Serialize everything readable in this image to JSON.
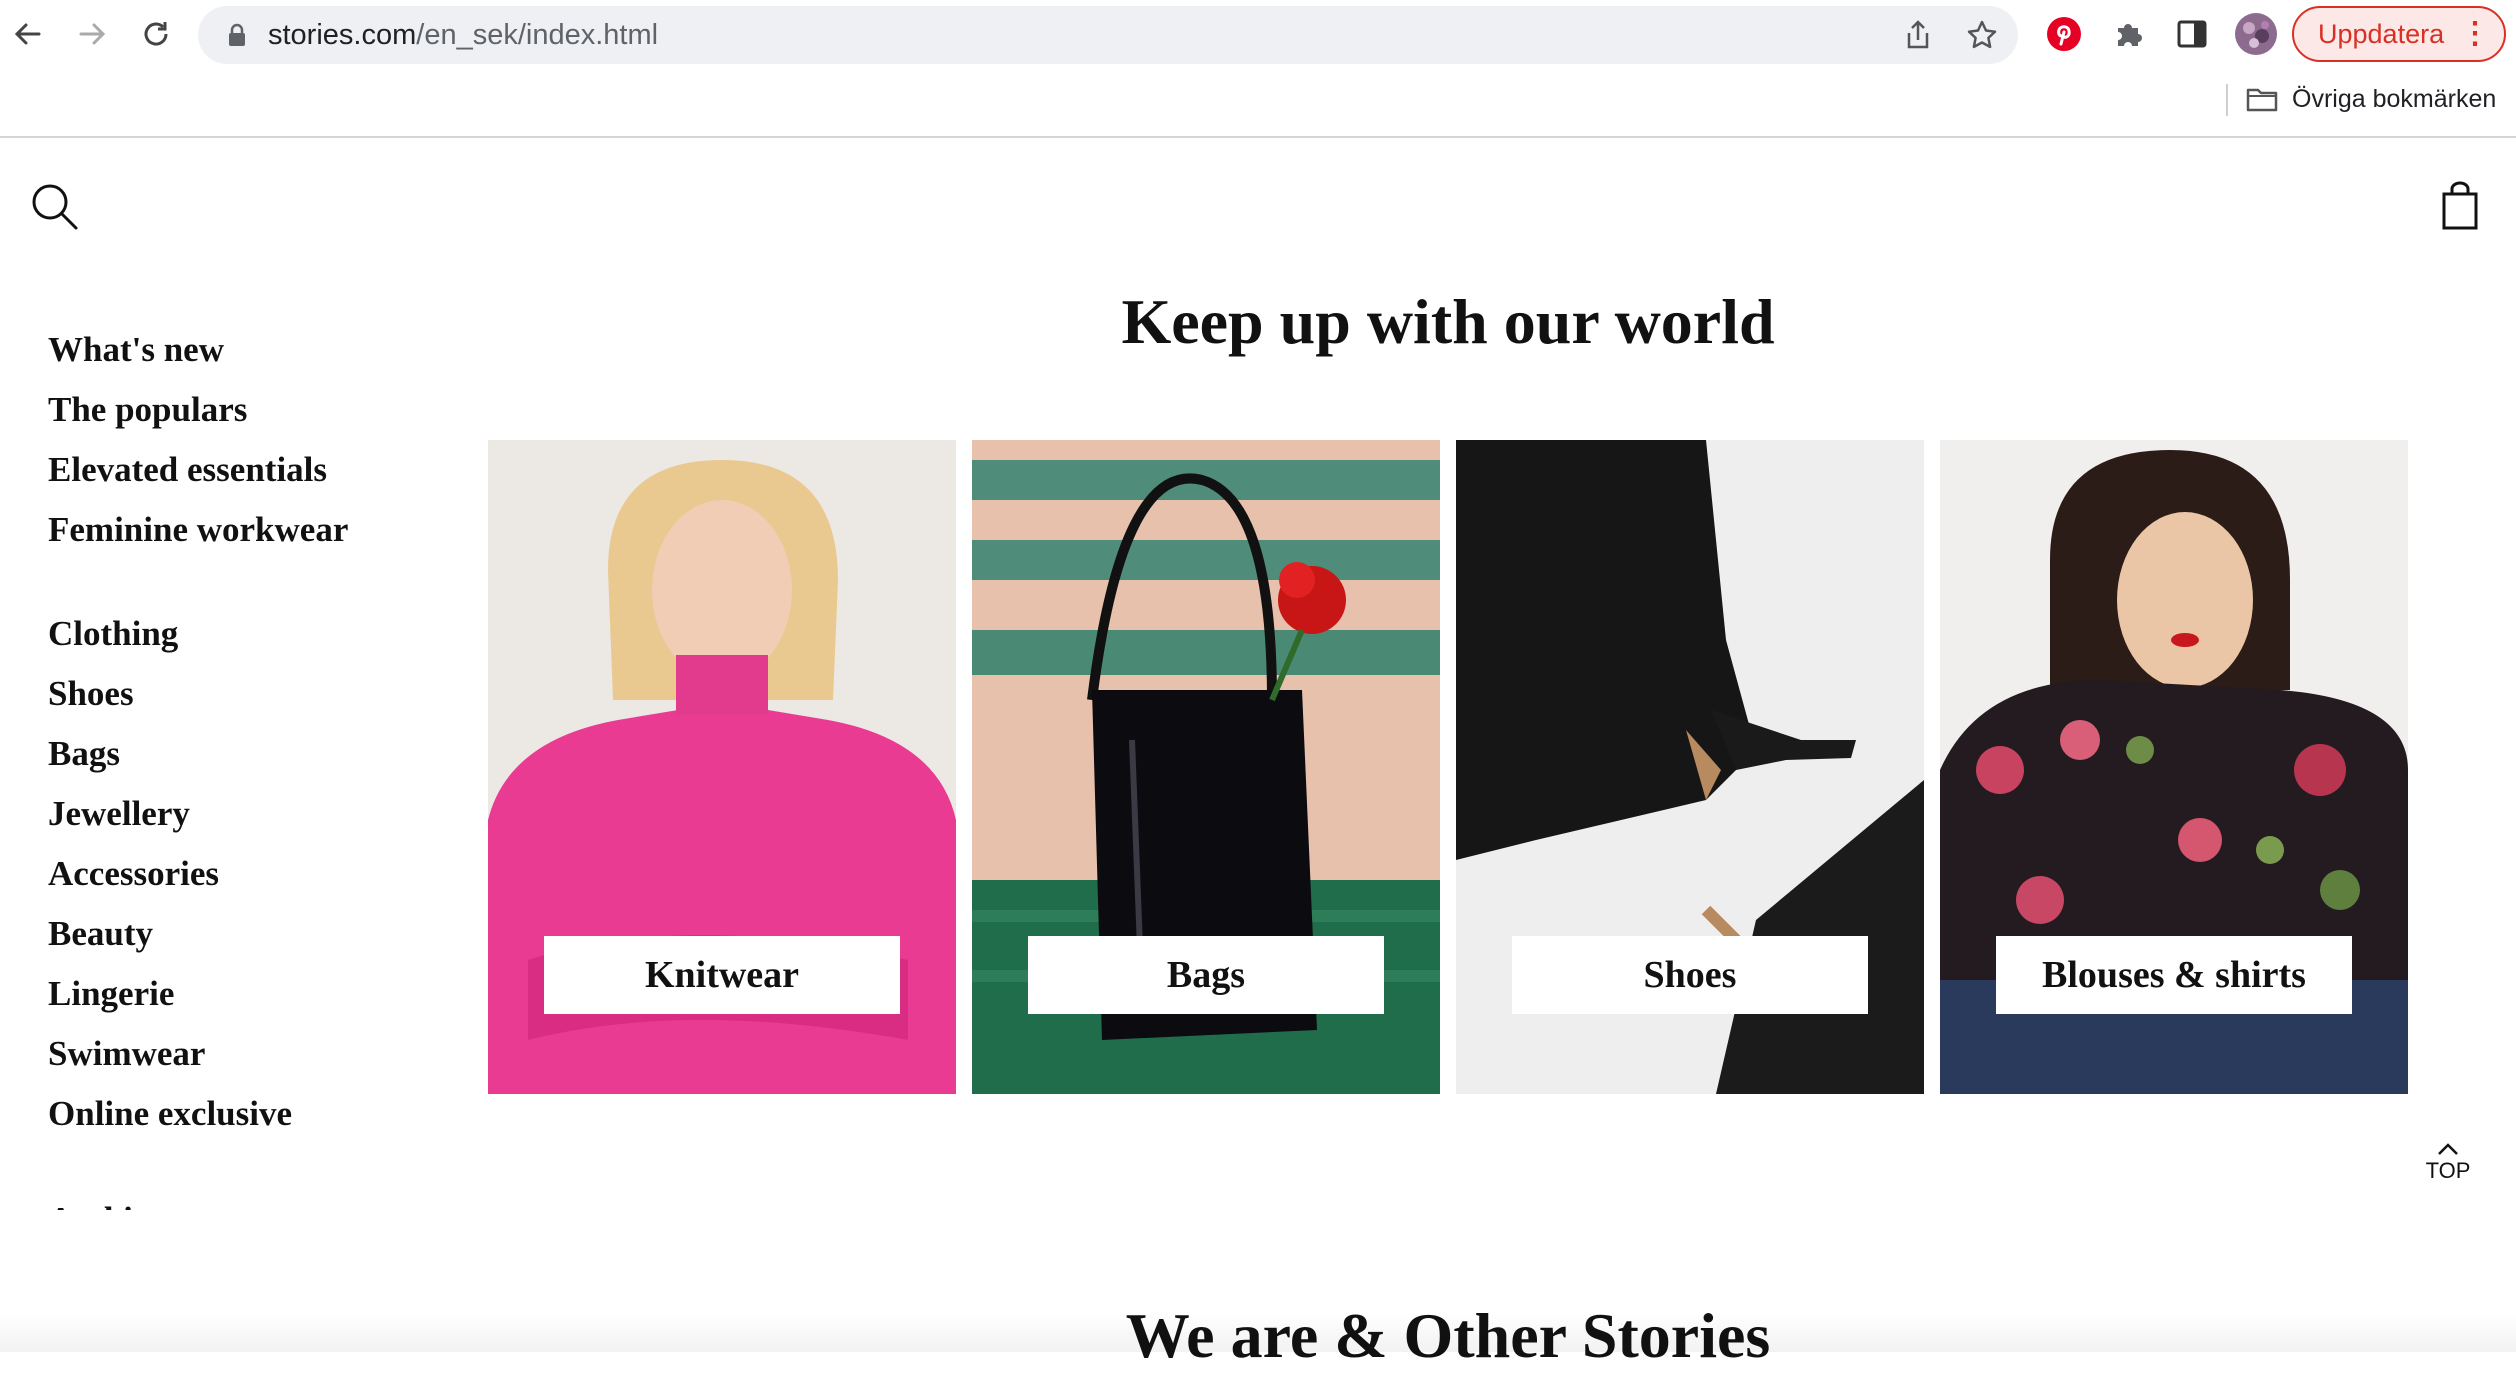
{
  "browser": {
    "url_host": "stories.com",
    "url_path": "/en_sek/index.html",
    "update_label": "Uppdatera",
    "bookmarks_label": "Övriga bokmärken",
    "colors": {
      "update": "#d93025",
      "pinterest": "#e60023"
    }
  },
  "site": {
    "hero_title": "Keep up with our world",
    "section_title": "We are & Other Stories",
    "top_label": "TOP",
    "nav_primary": [
      "What's new",
      "The populars",
      "Elevated essentials",
      "Feminine workwear"
    ],
    "nav_categories": [
      "Clothing",
      "Shoes",
      "Bags",
      "Jewellery",
      "Accessories",
      "Beauty",
      "Lingerie",
      "Swimwear",
      "Online exclusive"
    ],
    "nav_cut_off": "Archive",
    "cards": [
      {
        "label": "Knitwear",
        "image": "model in pink knit sweater"
      },
      {
        "label": "Bags",
        "image": "black patent tote bag on green bench"
      },
      {
        "label": "Shoes",
        "image": "black leather heeled boots"
      },
      {
        "label": "Blouses & shirts",
        "image": "model in floral blouse"
      }
    ]
  }
}
